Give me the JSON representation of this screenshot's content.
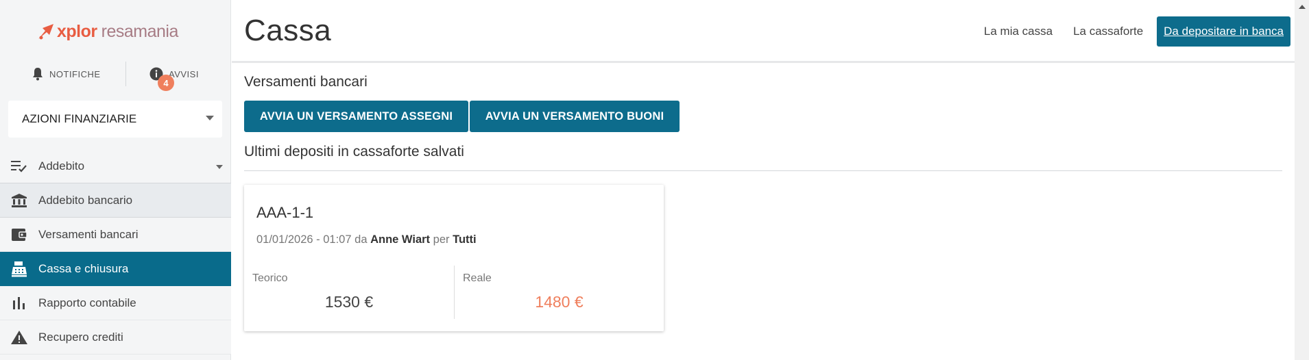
{
  "brand": {
    "name_part1": "xplor",
    "name_part2": "resamania"
  },
  "alerts": {
    "notifications_label": "NOTIFICHE",
    "warnings_label": "AVVISI",
    "warnings_count": "4"
  },
  "sidebar": {
    "dropdown_label": "AZIONI FINANZIARIE",
    "items": [
      {
        "label": "Addebito",
        "icon": "checklist-icon"
      },
      {
        "label": "Addebito bancario",
        "icon": "bank-icon"
      },
      {
        "label": "Versamenti bancari",
        "icon": "wallet-icon"
      },
      {
        "label": "Cassa e chiusura",
        "icon": "cash-register-icon"
      },
      {
        "label": "Rapporto contabile",
        "icon": "bar-chart-icon"
      },
      {
        "label": "Recupero crediti",
        "icon": "warning-icon"
      }
    ]
  },
  "header": {
    "title": "Cassa",
    "links": [
      "La mia cassa",
      "La cassaforte"
    ],
    "primary_link": "Da depositare in banca"
  },
  "main": {
    "section1_title": "Versamenti bancari",
    "buttons": [
      "AVVIA UN VERSAMENTO ASSEGNI",
      "AVVIA UN VERSAMENTO BUONI"
    ],
    "section2_title": "Ultimi depositi in cassaforte salvati",
    "card": {
      "title": "AAA-1-1",
      "datetime": "01/01/2026 - 01:07",
      "by_word": "da",
      "user": "Anne Wiart",
      "for_word": "per",
      "target": "Tutti",
      "theoretical_label": "Teorico",
      "theoretical_value": "1530 €",
      "real_label": "Reale",
      "real_value": "1480 €"
    }
  },
  "colors": {
    "accent": "#0d6c8c",
    "brand_orange": "#e85d42",
    "alert": "#ef7f5d"
  }
}
